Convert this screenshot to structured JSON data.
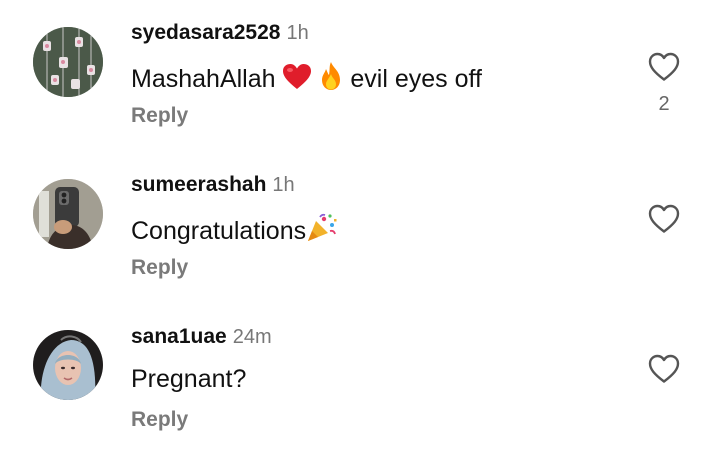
{
  "comments": [
    {
      "username": "syedasara2528",
      "time": "1h",
      "text": "MashahAllah",
      "text_after_emoji": "evil eyes off",
      "emojis": [
        "red-heart",
        "fire"
      ],
      "reply_label": "Reply",
      "like_count": "2"
    },
    {
      "username": "sumeerashah",
      "time": "1h",
      "text": "Congratulations",
      "emojis": [
        "party-popper"
      ],
      "reply_label": "Reply"
    },
    {
      "username": "sana1uae",
      "time": "24m",
      "text": "Pregnant?",
      "reply_label": "Reply"
    }
  ],
  "colors": {
    "username": "#111111",
    "timestamp": "#777777",
    "reply": "#7a7a7a",
    "heart_outline": "#555555",
    "background": "#ffffff"
  }
}
